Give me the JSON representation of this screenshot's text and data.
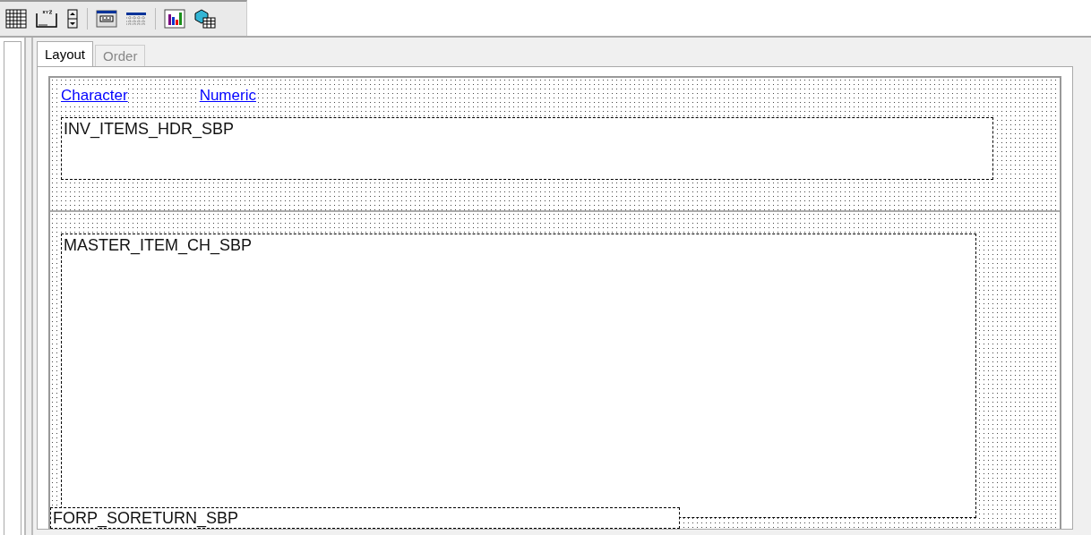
{
  "tabs": [
    {
      "label": "Layout",
      "selected": true
    },
    {
      "label": "Order",
      "selected": false
    }
  ],
  "header_links": [
    "Character",
    "Numeric"
  ],
  "header_band": {
    "title": "INV_ITEMS_HDR_SBP"
  },
  "detail_band": {
    "title": "MASTER_ITEM_CH_SBP"
  },
  "footer_band": {
    "title": "FORP_SORETURN_SBP"
  }
}
